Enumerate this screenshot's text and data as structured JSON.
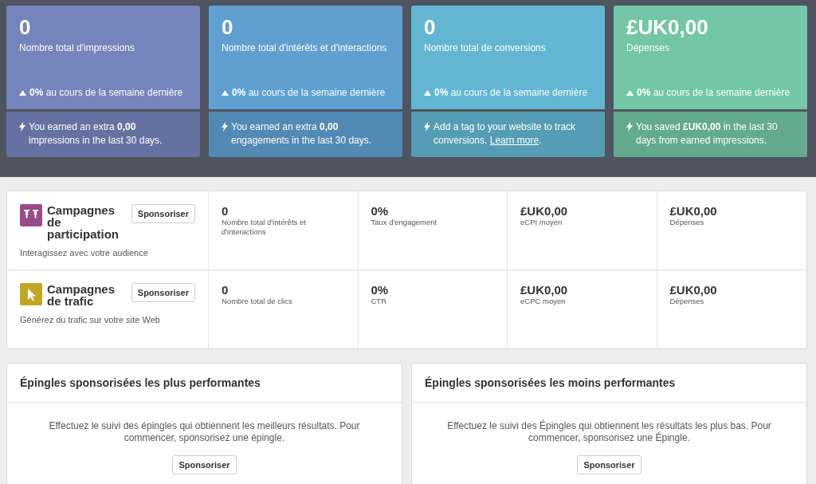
{
  "summary_cards": [
    {
      "value": "0",
      "label": "Nombre total d'impressions",
      "trend": "**0%** au cours de la semaine dernière",
      "color": "#7585bb",
      "note": {
        "text": "You earned an extra **0,00** impressions in the last 30 days."
      }
    },
    {
      "value": "0",
      "label": "Nombre total d'intérêts et d'interactions",
      "trend": "**0%** au cours de la semaine dernière",
      "color": "#5fa0d1",
      "note": {
        "text": "You earned an extra **0,00** engagements in the last 30 days."
      }
    },
    {
      "value": "0",
      "label": "Nombre total de conversions",
      "trend": "**0%** au cours de la semaine dernière",
      "color": "#63b6d1",
      "note": {
        "text": "Add a tag to your website to track conversions.",
        "link": "Learn more",
        "after": "."
      }
    },
    {
      "value": "£UK0,00",
      "label": "Dépenses",
      "trend": "**0%** au cours de la semaine dernière",
      "color": "#73c6a6",
      "note": {
        "text": "You saved **£UK0,00** in the last 30 days from earned impressions."
      }
    }
  ],
  "campaigns": [
    {
      "kind": "pin",
      "color": "#9b4a8c",
      "title": "Campagnes de participation",
      "description": "Interagissez avec votre audience",
      "button": "Sponsoriser",
      "metrics": [
        {
          "value": "0",
          "label": "Nombre total d'intérêts et d'interactions"
        },
        {
          "value": "0%",
          "label": "Taux d'engagement"
        },
        {
          "value": "£UK0,00",
          "label": "eCPI moyen"
        },
        {
          "value": "£UK0,00",
          "label": "Dépenses"
        }
      ]
    },
    {
      "kind": "cursor",
      "color": "#c3a524",
      "title": "Campagnes de trafic",
      "description": "Générez du trafic sur votre site Web",
      "button": "Sponsoriser",
      "metrics": [
        {
          "value": "0",
          "label": "Nombre total de clics"
        },
        {
          "value": "0%",
          "label": "CTR"
        },
        {
          "value": "£UK0,00",
          "label": "eCPC moyen"
        },
        {
          "value": "£UK0,00",
          "label": "Dépenses"
        }
      ]
    }
  ],
  "pin_panels": [
    {
      "title": "Épingles sponsorisées les plus performantes",
      "message": "Effectuez le suivi des épingles qui obtiennent les meilleurs résultats. Pour commencer, sponsorisez une épingle.",
      "button": "Sponsoriser"
    },
    {
      "title": "Épingles sponsorisées les moins performantes",
      "message": "Effectuez le suivi des Épingles qui obtiennent les résultats les plus bas. Pour commencer, sponsorisez une Épingle.",
      "button": "Sponsoriser"
    }
  ]
}
